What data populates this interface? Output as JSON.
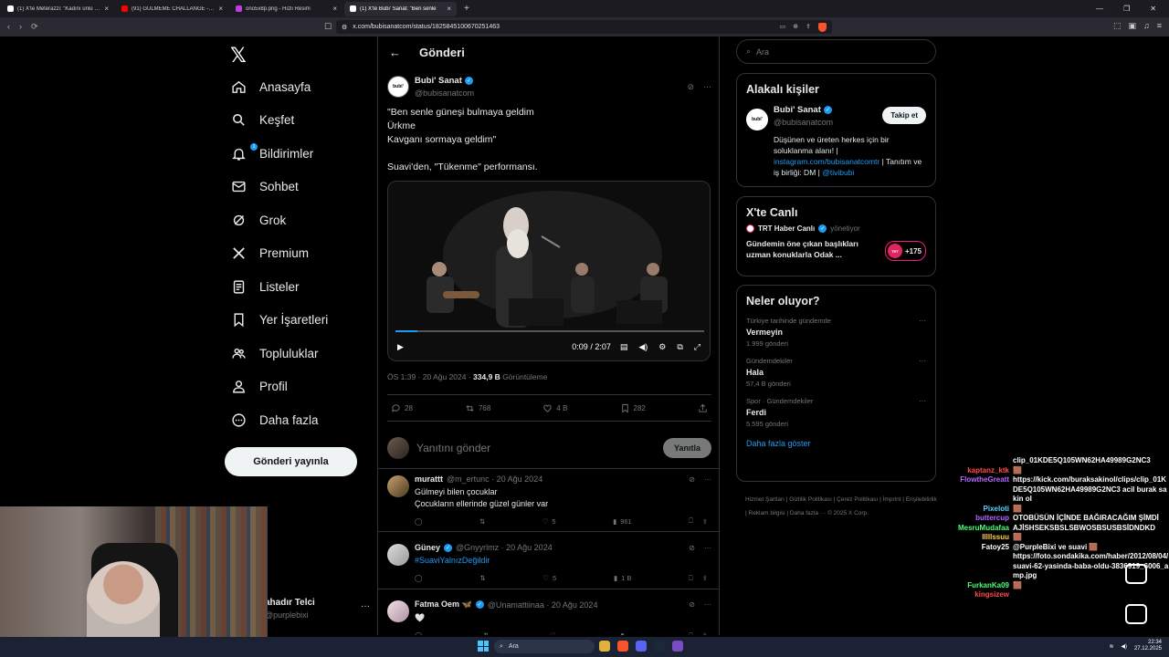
{
  "browser": {
    "tabs": [
      {
        "title": "(1) X'te Meterazzi: \"Kadını ünlü eden",
        "color": "#ffffff",
        "active": false
      },
      {
        "title": "(91) GÜLMEME CHALLANGE - YouTu",
        "color": "#ff0000",
        "active": false
      },
      {
        "title": "ono5x8p.png - Hızlı Resim",
        "color": "#c23ce0",
        "active": false
      },
      {
        "title": "(1) X'te Bubi' Sanat: \"Ben senle",
        "color": "#ffffff",
        "active": true
      }
    ],
    "url": "x.com/bubisanatcom/status/1825845100670251463"
  },
  "nav": {
    "items": [
      {
        "label": "Anasayfa",
        "icon": "home-icon"
      },
      {
        "label": "Keşfet",
        "icon": "search-icon"
      },
      {
        "label": "Bildirimler",
        "icon": "bell-icon"
      },
      {
        "label": "Sohbet",
        "icon": "mail-icon"
      },
      {
        "label": "Grok",
        "icon": "grok-icon"
      },
      {
        "label": "Premium",
        "icon": "x-icon"
      },
      {
        "label": "Listeler",
        "icon": "list-icon"
      },
      {
        "label": "Yer İşaretleri",
        "icon": "bookmark-icon"
      },
      {
        "label": "Topluluklar",
        "icon": "people-icon"
      },
      {
        "label": "Profil",
        "icon": "person-icon"
      },
      {
        "label": "Daha fazla",
        "icon": "more-circle-icon"
      }
    ],
    "notif_count": "1",
    "post_button": "Gönderi yayınla",
    "profile_name": "ahadır Telci",
    "profile_handle": "@purplebixi"
  },
  "post": {
    "header": "Gönderi",
    "author_name": "Bubi' Sanat",
    "author_handle": "@bubisanatcom",
    "avatar_text": "bubi'",
    "text": "\"Ben senle güneşi bulmaya geldim\nÜrkme\nKavganı sormaya geldim\"\n\n Suavi'den, \"Tükenme\" performansı.",
    "video_time": "0:09 / 2:07",
    "video_progress": 0.07,
    "time": "ÖS 1:39 · 20 Ağu 2024 · ",
    "views": "334,9 B",
    "views_label": " Görüntüleme",
    "replies": "28",
    "reposts": "768",
    "likes": "4 B",
    "bookmarks": "282",
    "reply_placeholder": "Yanıtını gönder",
    "reply_button": "Yanıtla"
  },
  "comments": [
    {
      "name": "murattt",
      "meta": "@m_ertunc · 20 Ağu 2024",
      "text": "Gülmeyi bilen çocuklar\nÇocukların ellerinde güzel günler var",
      "link": false,
      "reposts": "",
      "likes": "5",
      "views": "961",
      "verified": false
    },
    {
      "name": "Güney",
      "meta": "@Gnyyrlmz · 20 Ağu 2024",
      "text": "#SuaviYalnızDeğildir",
      "link": true,
      "reposts": "",
      "likes": "5",
      "views": "1 B",
      "verified": true
    },
    {
      "name": "Fatma Oem 🦋",
      "meta": "@Unamattiinaa · 20 Ağu 2024",
      "text": "🤍",
      "link": false,
      "reposts": "",
      "likes": "",
      "views": "",
      "verified": true
    }
  ],
  "search_placeholder": "Ara",
  "related": {
    "title": "Alakalı kişiler",
    "name": "Bubi' Sanat",
    "handle": "@bubisanatcom",
    "follow": "Takip et",
    "bio_1": "Düşünen ve üreten herkes için bir soluklanma alanı! | ",
    "bio_link": "instagram.com/bubisanatcomtr",
    "bio_2": " | Tanıtım ve iş birliği: DM | ",
    "bio_mention": "@tivibubi"
  },
  "live": {
    "title": "X'te Canlı",
    "host": "TRT Haber Canlı",
    "host_role": "yönetiyor",
    "show": "Gündemin öne çıkan başlıkları uzman konuklarla Odak ...",
    "count": "+175"
  },
  "trends": {
    "title": "Neler oluyor?",
    "items": [
      {
        "category": "Türkiye tarihinde gündemde",
        "name": "Vermeyin",
        "count": "1.999 gönderi"
      },
      {
        "category": "Gündemdekiler",
        "name": "Hala",
        "count": "57,4 B gönderi"
      },
      {
        "category": "Spor · Gündemdekiler",
        "name": "Ferdi",
        "count": "5.595 gönderi"
      }
    ],
    "show_more": "Daha fazla göster"
  },
  "footer": "Hizmet Şartları | Gizlilik Politikası | Çerez Politikası | İmprint | Erişilebilirlik | Reklam bilgisi | Daha fazla ··· © 2025 X Corp.",
  "chat": [
    {
      "user": "",
      "color": "#ffffff",
      "msg": "clip_01KDE5Q105WN62HA49989G2NC3"
    },
    {
      "user": "kaptanz_ktk",
      "color": "#ff4c4c",
      "msg": "🟫"
    },
    {
      "user": "FlowtheGreatt",
      "color": "#b469ff",
      "msg": "https://kick.com/buraksakinol/clips/clip_01KDE5Q105WN62HA49989G2NC3 acil burak sakin ol"
    },
    {
      "user": "Pixeloti",
      "color": "#5fd4ff",
      "msg": "🟫"
    },
    {
      "user": "buttercup",
      "color": "#b469ff",
      "msg": "OTOBÜSÜN İÇİNDE BAĞIRACAĞIM ŞİMDİ"
    },
    {
      "user": "MesruMudafaa",
      "color": "#4cff7a",
      "msg": "AJİSHSEKSBSLSBWOSBSUSBSİDNDKD"
    },
    {
      "user": "lllllssuu",
      "color": "#ffd24c",
      "msg": "🟫"
    },
    {
      "user": "Fatoy25",
      "color": "#ffffff",
      "msg": "@PurpleBixi ve suavi 🟫"
    },
    {
      "user": "",
      "color": "#ffffff",
      "msg": "https://foto.sondakika.com/haber/2012/08/04/suavi-62-yasinda-baba-oldu-3836919_6006_amp.jpg"
    },
    {
      "user": "FurkanKa09",
      "color": "#4cff7a",
      "msg": "🟫"
    },
    {
      "user": "kingsizew",
      "color": "#ff4c4c",
      "msg": ""
    }
  ],
  "taskbar": {
    "search": "Ara",
    "time": "22:34",
    "date": "27.12.2025"
  }
}
